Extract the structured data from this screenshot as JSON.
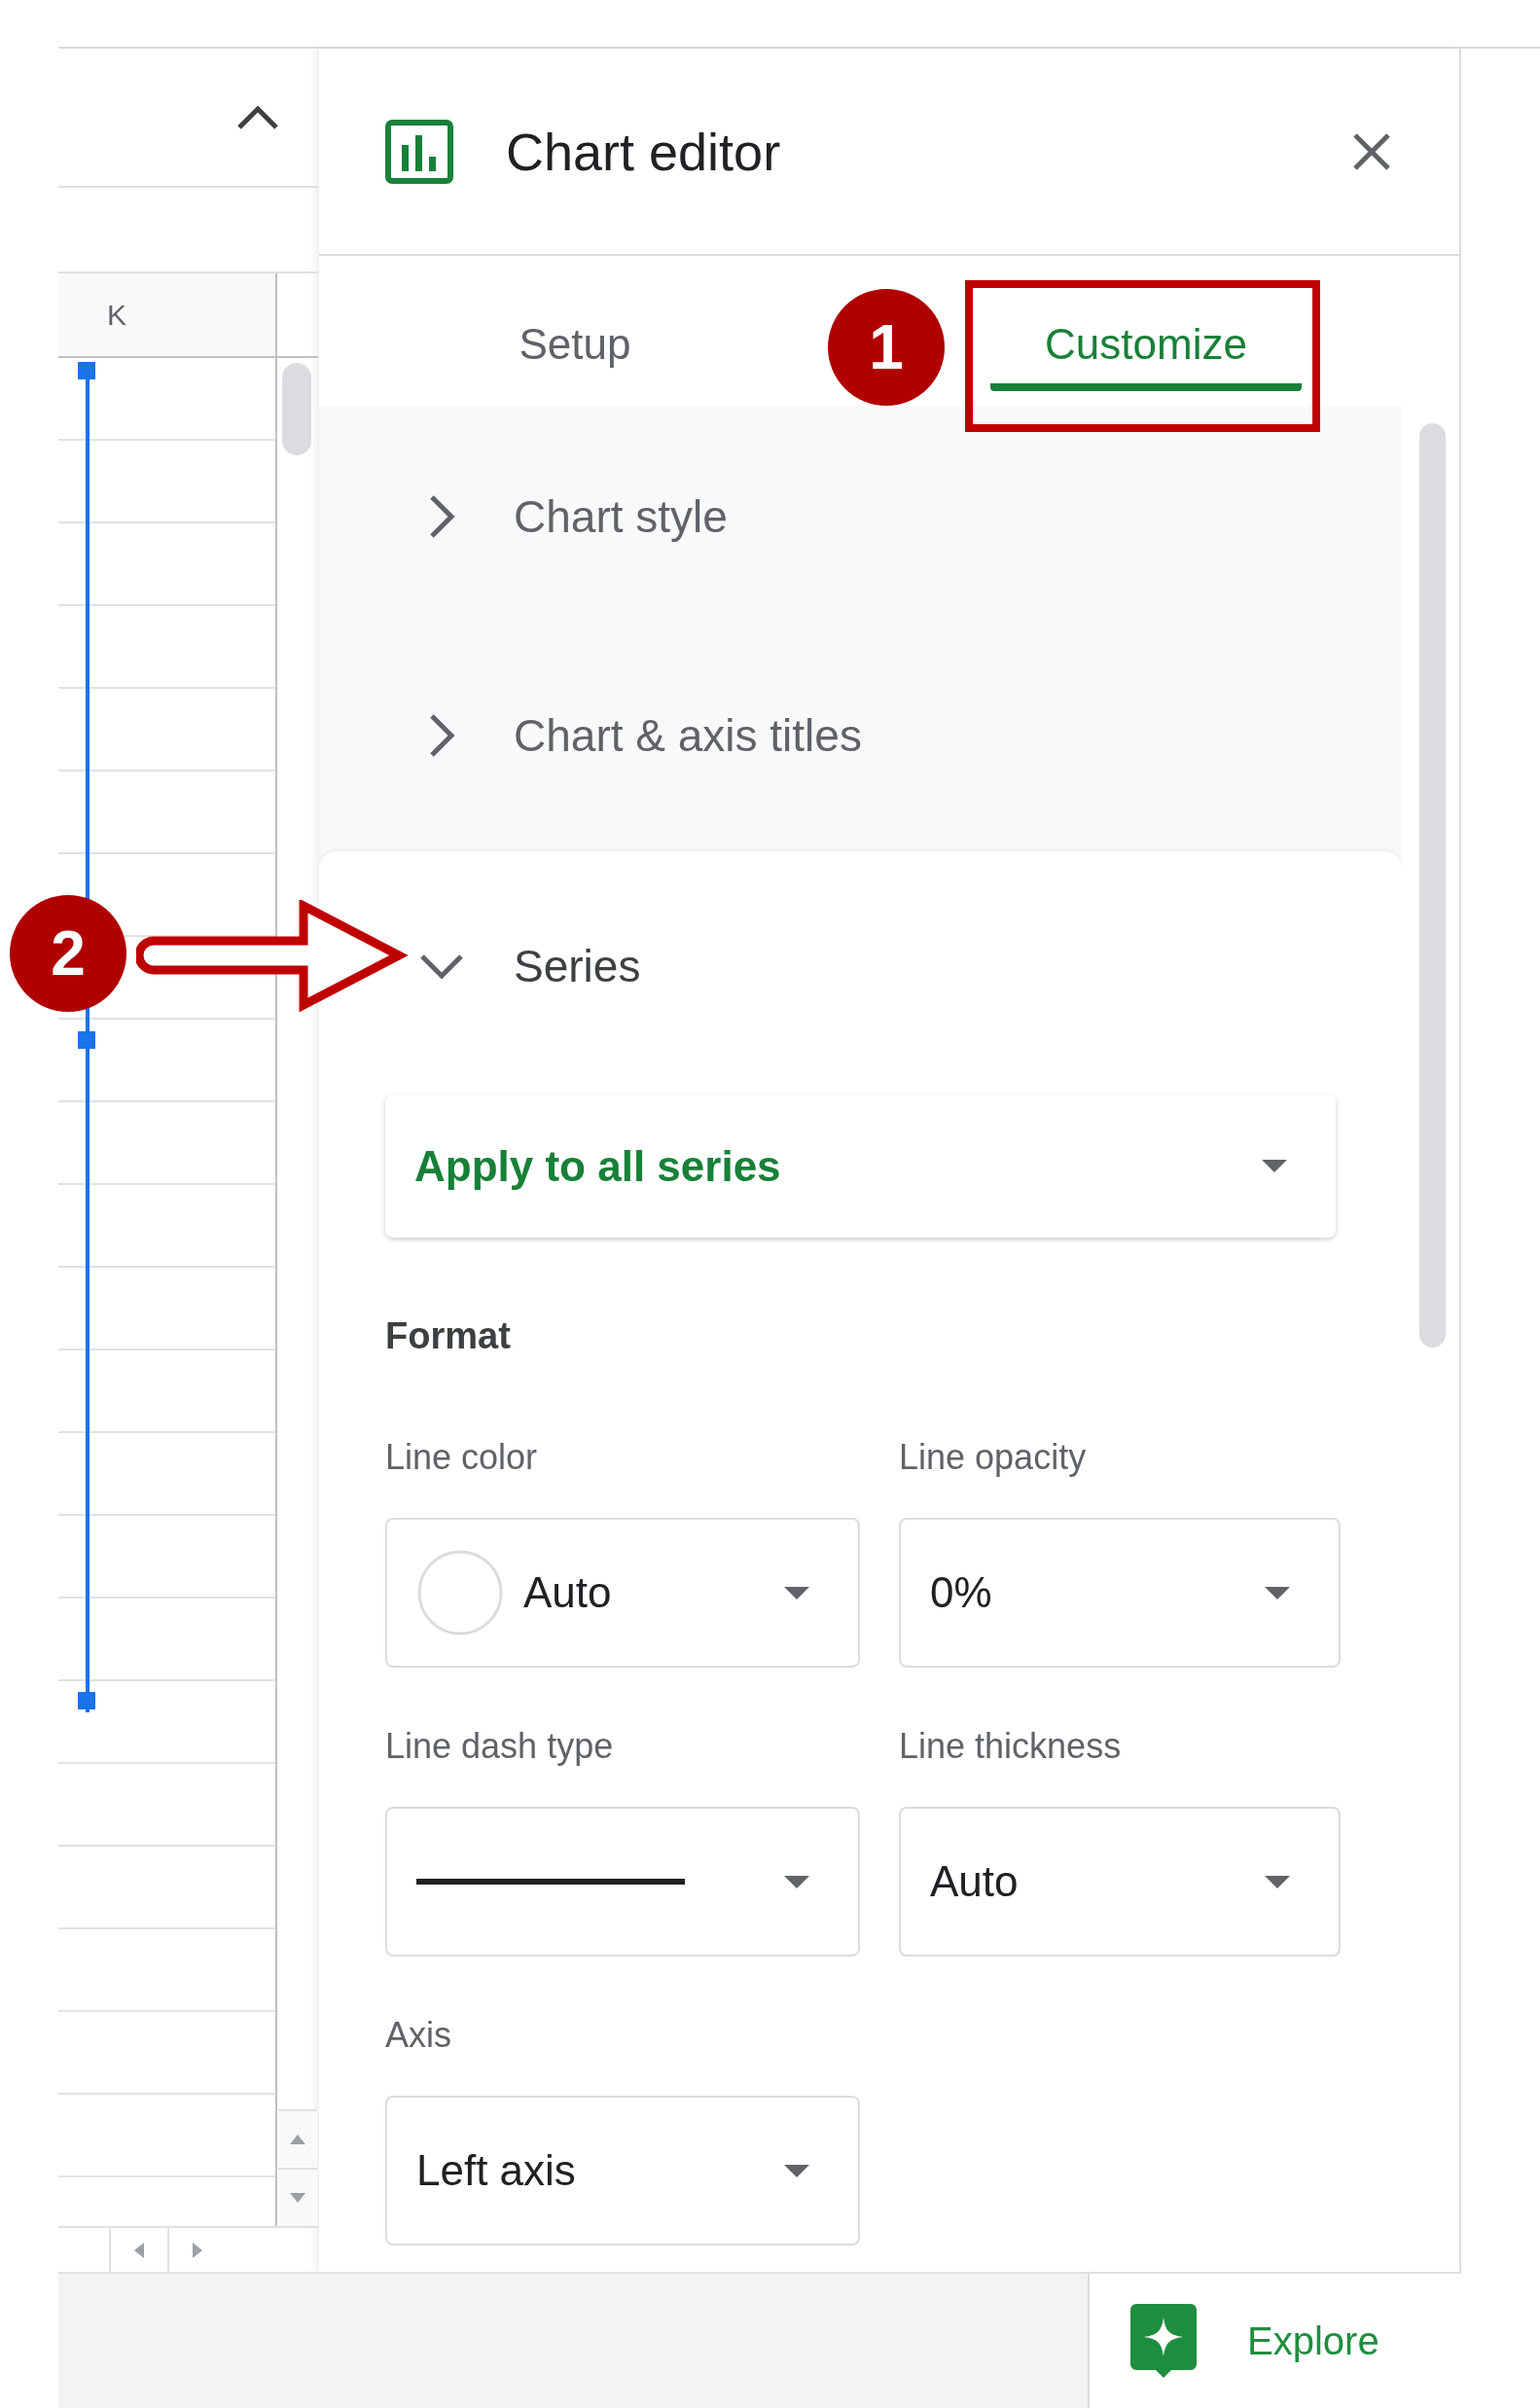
{
  "sheet": {
    "column_header": "K"
  },
  "chart_editor": {
    "title": "Chart editor",
    "tabs": [
      {
        "label": "Setup",
        "selected": false
      },
      {
        "label": "Customize",
        "selected": true
      }
    ],
    "sections": [
      {
        "label": "Chart style",
        "expanded": false
      },
      {
        "label": "Chart & axis titles",
        "expanded": false
      },
      {
        "label": "Series",
        "expanded": true
      }
    ],
    "series_dropdown": "Apply to all series",
    "format_heading": "Format",
    "fields": [
      {
        "label": "Line color",
        "value": "Auto",
        "kind": "color"
      },
      {
        "label": "Line opacity",
        "value": "0%",
        "kind": "text"
      },
      {
        "label": "Line dash type",
        "kind": "dash"
      },
      {
        "label": "Line thickness",
        "value": "Auto",
        "kind": "text"
      },
      {
        "label": "Axis",
        "value": "Left axis",
        "kind": "text"
      }
    ]
  },
  "explore": {
    "label": "Explore"
  },
  "annotations": [
    {
      "number": "1"
    },
    {
      "number": "2"
    }
  ]
}
